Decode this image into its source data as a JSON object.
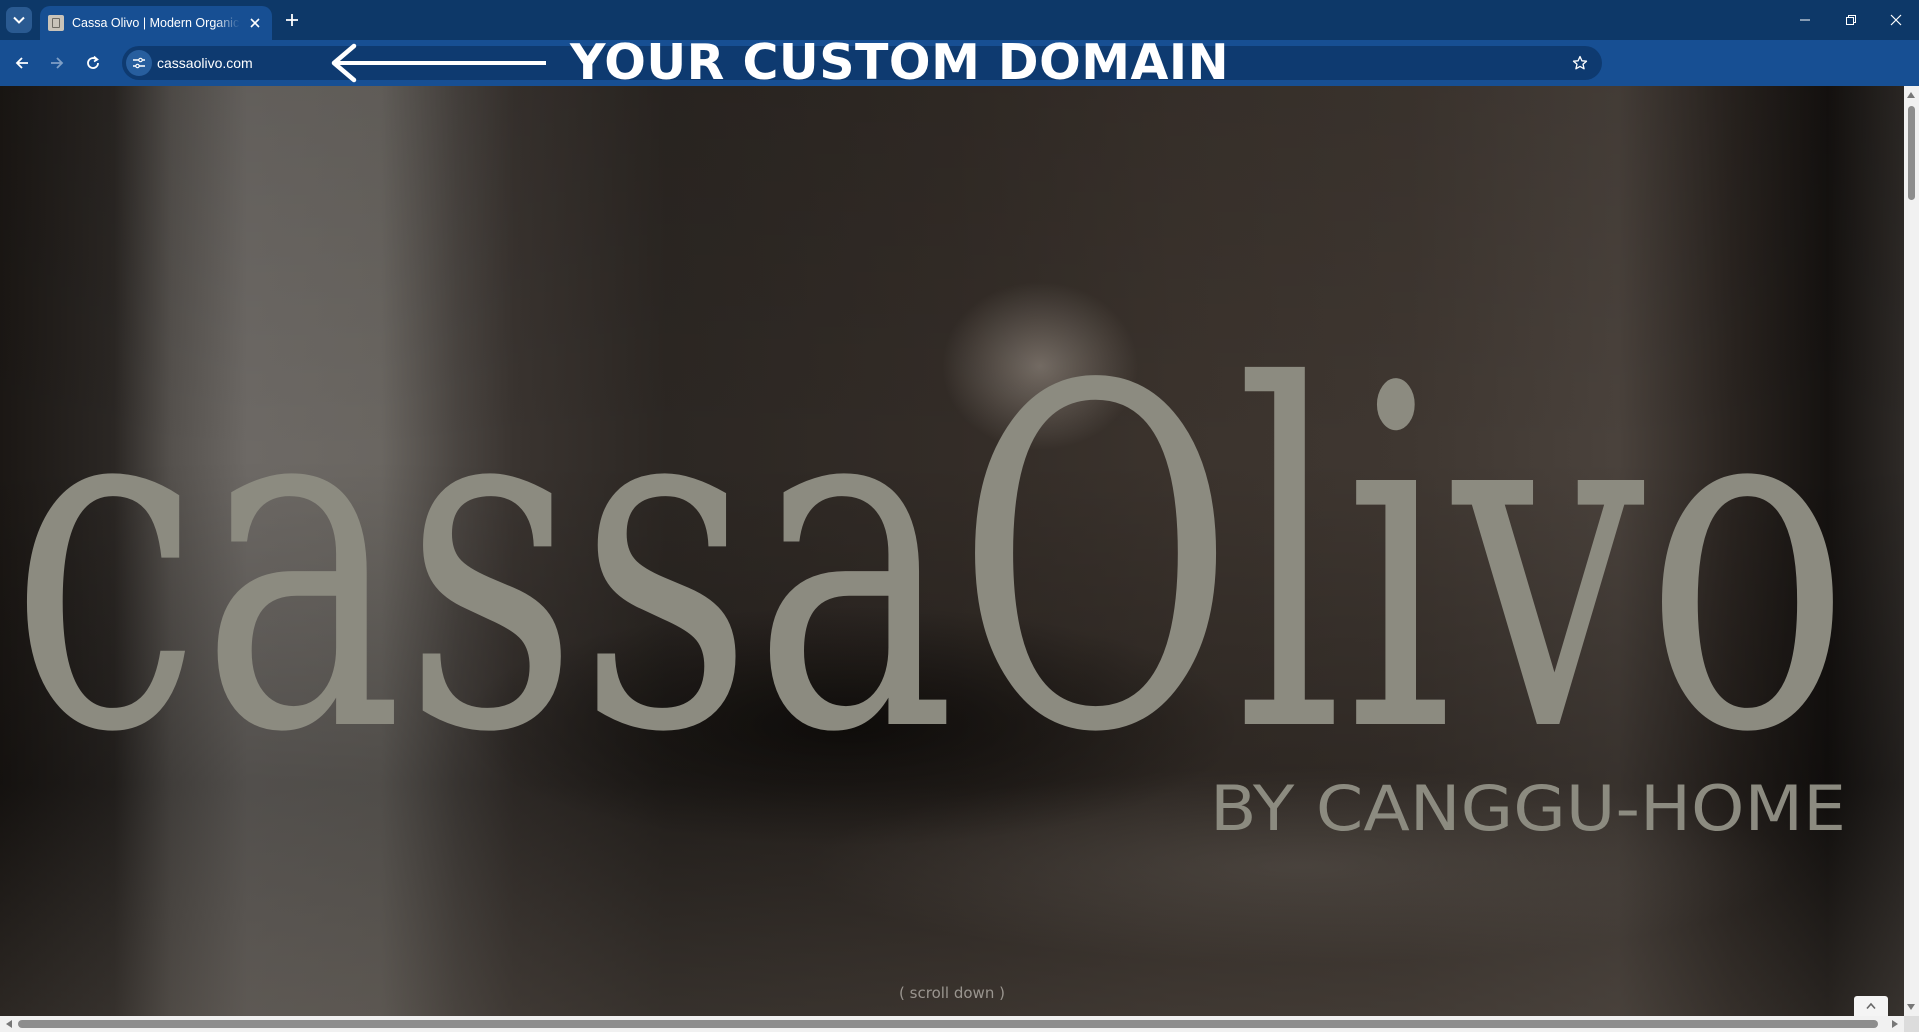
{
  "browser": {
    "tab": {
      "title": "Cassa Olivo | Modern Organic Interiors"
    },
    "address_bar": {
      "url": "cassaolivo.com"
    },
    "annotation": {
      "text": "YOUR CUSTOM DOMAIN"
    }
  },
  "page": {
    "logo": {
      "name": "cassaOlivo",
      "byline": "BY CANGGU-HOME"
    },
    "scroll_hint": "( scroll down )"
  },
  "colors": {
    "chrome_tabstrip": "#0d3868",
    "chrome_toolbar": "#174f93",
    "logo_text": "#8c8b80"
  }
}
